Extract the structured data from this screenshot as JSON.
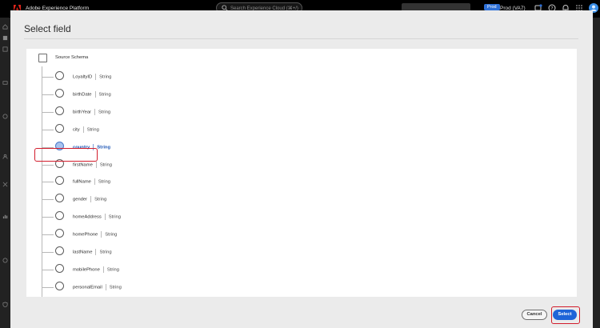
{
  "topbar": {
    "app_title": "Adobe Experience Platform",
    "search_placeholder": "Search Experience Cloud (⌘+/)",
    "env_badge": "Prod",
    "sandbox_label": "Prod (VA7)"
  },
  "dialog": {
    "title": "Select field",
    "root_label": "Source Schema",
    "fields": [
      {
        "name": "LoyaltyID",
        "type": "String",
        "selected": false
      },
      {
        "name": "birthDate",
        "type": "String",
        "selected": false
      },
      {
        "name": "birthYear",
        "type": "String",
        "selected": false
      },
      {
        "name": "city",
        "type": "String",
        "selected": false
      },
      {
        "name": "country",
        "type": "String",
        "selected": true
      },
      {
        "name": "firstName",
        "type": "String",
        "selected": false
      },
      {
        "name": "fullName",
        "type": "String",
        "selected": false
      },
      {
        "name": "gender",
        "type": "String",
        "selected": false
      },
      {
        "name": "homeAddress",
        "type": "String",
        "selected": false
      },
      {
        "name": "homePhone",
        "type": "String",
        "selected": false
      },
      {
        "name": "lastName",
        "type": "String",
        "selected": false
      },
      {
        "name": "mobilePhone",
        "type": "String",
        "selected": false
      },
      {
        "name": "personalEmail",
        "type": "String",
        "selected": false
      }
    ],
    "cancel_label": "Cancel",
    "select_label": "Select"
  },
  "colors": {
    "accent": "#1e64d8",
    "highlight": "#d21c2c",
    "selected_text": "#1b55b5"
  }
}
